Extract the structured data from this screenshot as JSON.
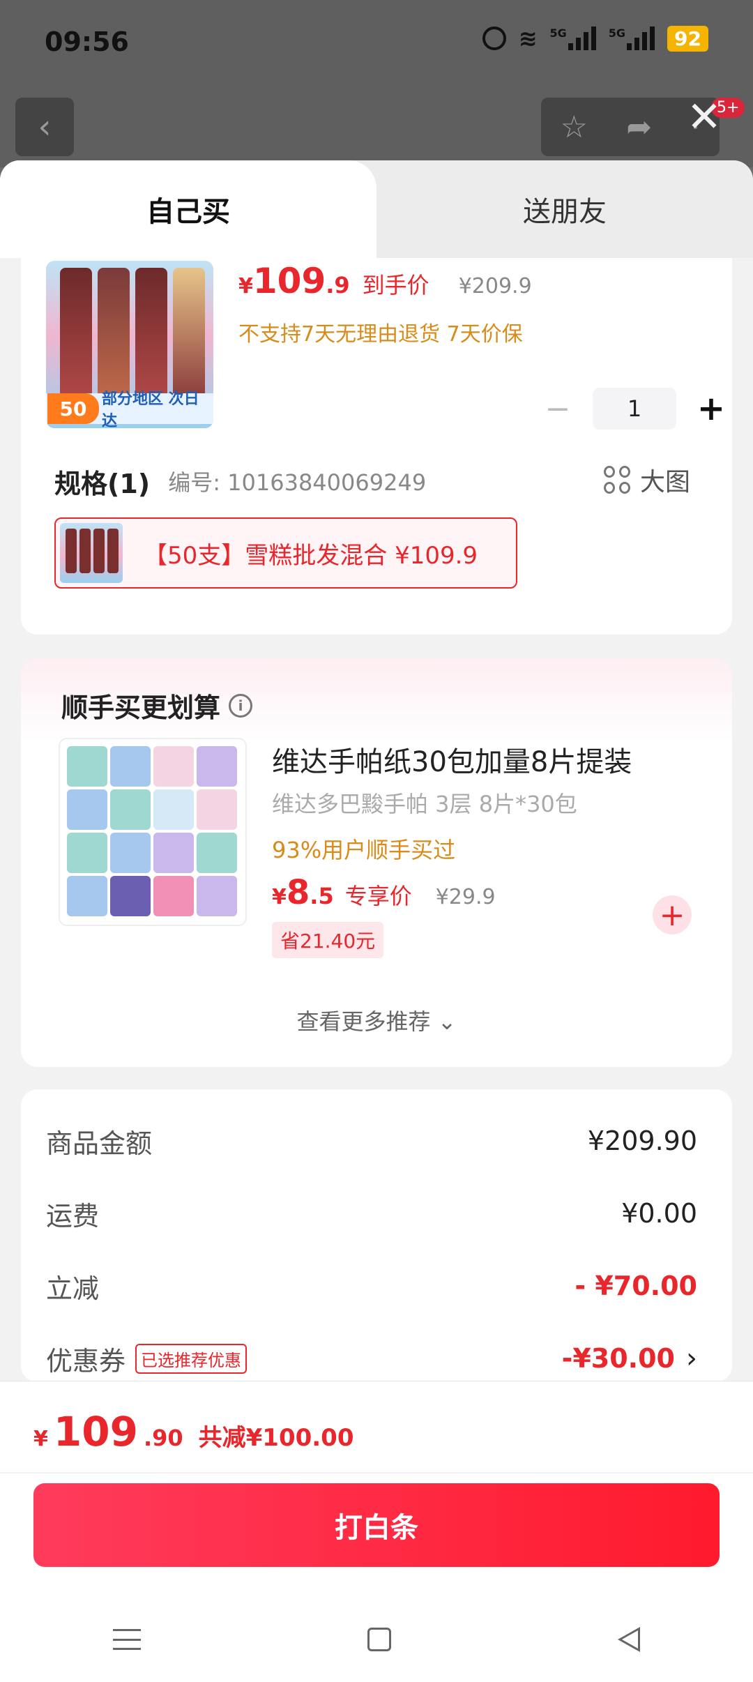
{
  "status_bar": {
    "time": "09:56",
    "network_1": "5G",
    "network_2": "5G",
    "battery": "92"
  },
  "background_page": {
    "back_icon": "chevron-left-icon",
    "badge": "5+"
  },
  "tabs": {
    "self": "自己买",
    "friend": "送朋友"
  },
  "product": {
    "image_badge": "50",
    "image_caption": "部分地区 次日达",
    "price_currency": "¥",
    "price_int": "109",
    "price_dec": ".9",
    "price_label": "到手价",
    "original_price": "¥209.9",
    "policy": "不支持7天无理由退货  7天价保",
    "quantity": "1",
    "minus": "−",
    "plus": "+"
  },
  "spec": {
    "title": "规格(1)",
    "code": "编号: 10163840069249",
    "big_picture": "大图",
    "option": "【50支】雪糕批发混合  ¥109.9"
  },
  "recommend": {
    "title": "顺手买更划算",
    "info_icon": "ⓘ",
    "item_name": "维达手帕纸30包加量8片提装",
    "item_sub": "维达多巴黢手帕 3层 8片*30包",
    "item_pct": "93%用户顺手买过",
    "item_price_cur": "¥",
    "item_price_int": "8",
    "item_price_dec": ".5",
    "item_price_label": "专享价",
    "item_orig": "¥29.9",
    "item_save": "省21.40元",
    "add": "+",
    "more": "查看更多推荐 ⌄"
  },
  "summary": {
    "rows": [
      {
        "label": "商品金额",
        "value": "¥209.90"
      },
      {
        "label": "运费",
        "value": "¥0.00"
      },
      {
        "label": "立减",
        "value": "- ¥70.00"
      },
      {
        "label": "优惠券",
        "value": "-¥30.00"
      }
    ],
    "coupon_tag": "已选推荐优惠",
    "chevron": "›"
  },
  "footer": {
    "total_cur": "¥",
    "total_int": "109",
    "total_dec": ".90",
    "total_save": "共减¥100.00",
    "pay_button": "打白条"
  },
  "colors": {
    "accent": "#e8262b",
    "pay_button_start": "#ff3b5c",
    "pay_button_end": "#ff1a2d",
    "highlight": "#d98b1a"
  }
}
